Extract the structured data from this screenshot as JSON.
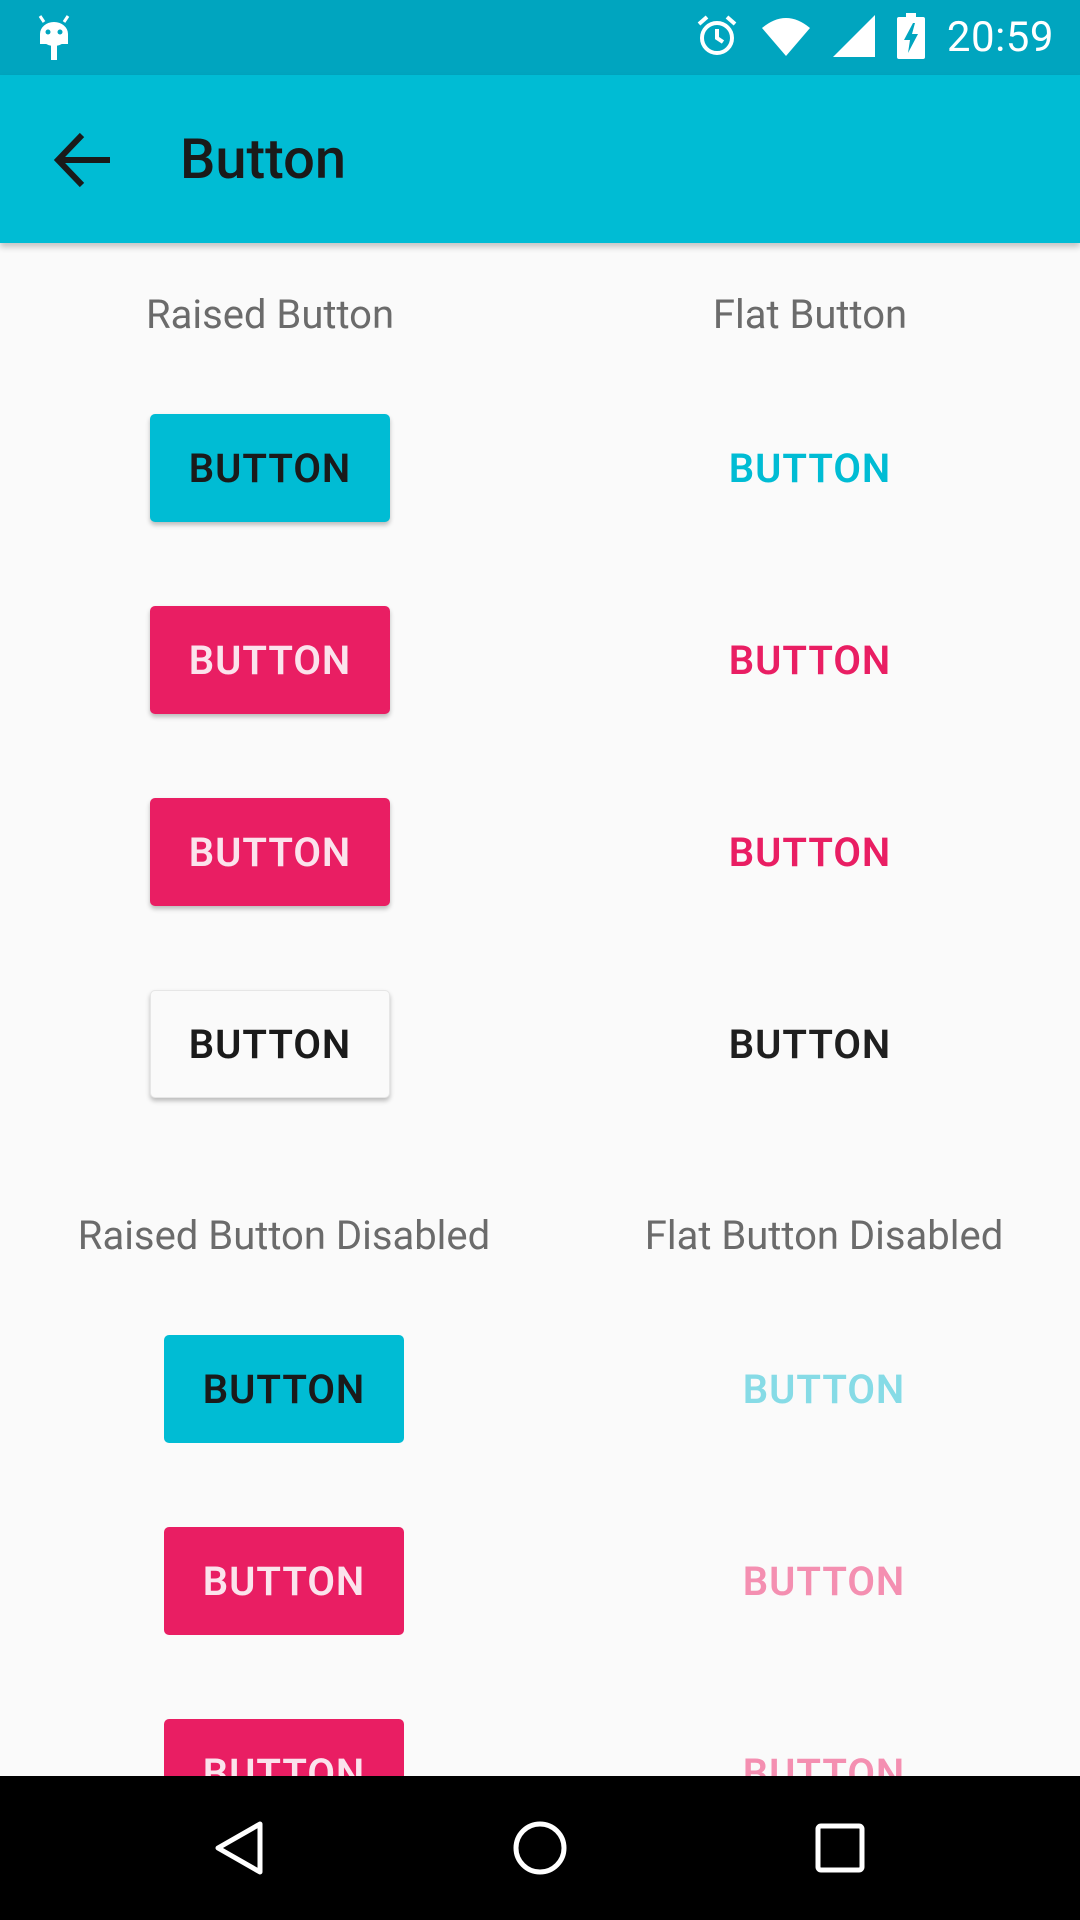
{
  "status_bar": {
    "time": "20:59",
    "icons": [
      "android-debug-icon",
      "alarm-icon",
      "wifi-icon",
      "signal-icon",
      "battery-charging-icon"
    ]
  },
  "app_bar": {
    "title": "Button",
    "back_icon": "arrow-back-icon"
  },
  "sections": {
    "enabled": {
      "raised_header": "Raised Button",
      "flat_header": "Flat Button",
      "raised_buttons": [
        "BUTTON",
        "BUTTON",
        "BUTTON",
        "BUTTON"
      ],
      "flat_buttons": [
        "BUTTON",
        "BUTTON",
        "BUTTON",
        "BUTTON"
      ]
    },
    "disabled": {
      "raised_header": "Raised Button Disabled",
      "flat_header": "Flat Button Disabled",
      "raised_buttons": [
        "BUTTON",
        "BUTTON",
        "BUTTON"
      ],
      "flat_buttons": [
        "BUTTON",
        "BUTTON",
        "BUTTON"
      ]
    }
  },
  "colors": {
    "primary": "#00BCD4",
    "primary_dark": "#00A5BF",
    "accent": "#E91E63",
    "background": "#FAFAFA"
  },
  "nav_bar": {
    "icons": [
      "nav-back-icon",
      "nav-home-icon",
      "nav-recents-icon"
    ]
  }
}
